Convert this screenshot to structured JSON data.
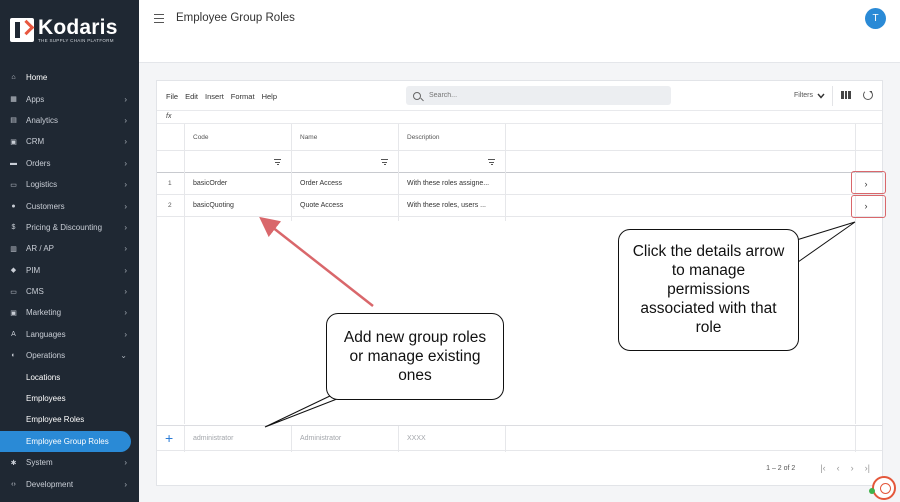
{
  "brand": {
    "name": "Kodaris",
    "tagline": "THE SUPPLY CHAIN PLATFORM"
  },
  "sidebar": {
    "items": [
      {
        "label": "Home",
        "icon": "home-icon",
        "glyph": "⌂",
        "chevron": false
      },
      {
        "label": "Apps",
        "icon": "apps-icon",
        "glyph": "▦",
        "chevron": true
      },
      {
        "label": "Analytics",
        "icon": "analytics-icon",
        "glyph": "▤",
        "chevron": true
      },
      {
        "label": "CRM",
        "icon": "crm-icon",
        "glyph": "▣",
        "chevron": true
      },
      {
        "label": "Orders",
        "icon": "orders-icon",
        "glyph": "▬",
        "chevron": true
      },
      {
        "label": "Logistics",
        "icon": "truck-icon",
        "glyph": "▭",
        "chevron": true
      },
      {
        "label": "Customers",
        "icon": "customers-icon",
        "glyph": "●",
        "chevron": true
      },
      {
        "label": "Pricing & Discounting",
        "icon": "dollar-icon",
        "glyph": "$",
        "chevron": true
      },
      {
        "label": "AR / AP",
        "icon": "ar-ap-icon",
        "glyph": "▥",
        "chevron": true
      },
      {
        "label": "PIM",
        "icon": "tag-icon",
        "glyph": "◆",
        "chevron": true
      },
      {
        "label": "CMS",
        "icon": "cms-icon",
        "glyph": "▭",
        "chevron": true
      },
      {
        "label": "Marketing",
        "icon": "marketing-icon",
        "glyph": "▣",
        "chevron": true
      },
      {
        "label": "Languages",
        "icon": "translate-icon",
        "glyph": "A",
        "chevron": true
      },
      {
        "label": "Operations",
        "icon": "operations-icon",
        "glyph": "◐",
        "chevron": "down"
      }
    ],
    "sub_items": [
      {
        "label": "Locations",
        "active": false
      },
      {
        "label": "Employees",
        "active": false
      },
      {
        "label": "Employee Roles",
        "active": false
      },
      {
        "label": "Employee Group Roles",
        "active": true
      }
    ],
    "bottom_items": [
      {
        "label": "System",
        "icon": "gear-icon",
        "glyph": "✱"
      },
      {
        "label": "Development",
        "icon": "code-icon",
        "glyph": "‹›"
      }
    ]
  },
  "header": {
    "title": "Employee Group Roles",
    "avatar_initial": "T"
  },
  "toolbar": {
    "menu": [
      "File",
      "Edit",
      "Insert",
      "Format",
      "Help"
    ],
    "search_placeholder": "Search...",
    "filters_label": "Filters",
    "fx_label": "fx"
  },
  "table": {
    "columns": [
      "Code",
      "Name",
      "Description"
    ],
    "rows": [
      {
        "num": "1",
        "code": "basicOrder",
        "name": "Order Access",
        "description": "With these roles assigne..."
      },
      {
        "num": "2",
        "code": "basicQuoting",
        "name": "Quote Access",
        "description": "With these roles, users ..."
      }
    ],
    "new_row_placeholders": {
      "code": "administrator",
      "name": "Administrator",
      "description": "XXXX"
    },
    "pagination": "1 – 2 of 2"
  },
  "annotations": {
    "details_callout": "Click the details arrow to manage permissions associated with that role",
    "add_callout": "Add new group roles or manage existing ones",
    "arrow_color": "#d9676b"
  },
  "colors": {
    "sidebar_bg": "#1f2833",
    "accent": "#2a8ad6",
    "brand_orange": "#e8573f"
  }
}
